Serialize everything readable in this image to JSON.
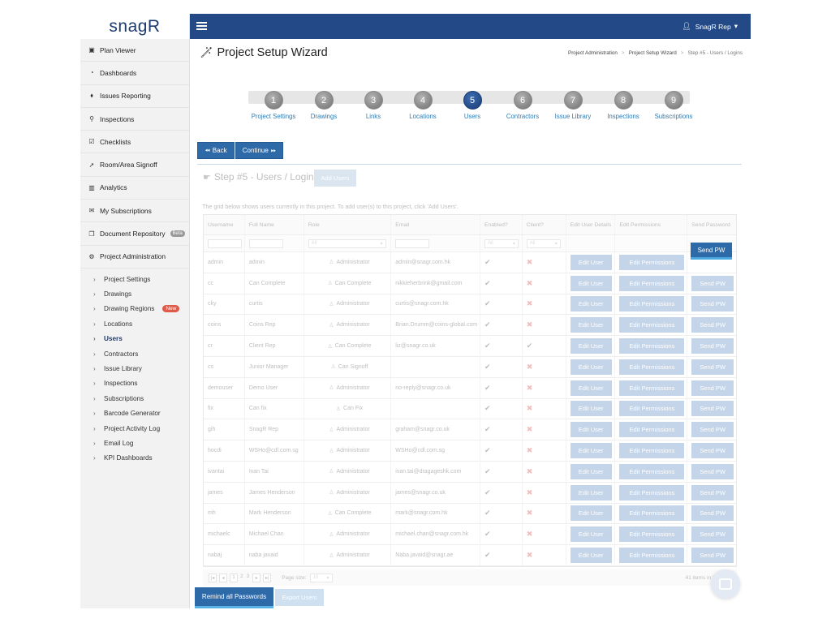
{
  "app": {
    "logo_text": "snagR"
  },
  "topbar": {
    "user_name": "SnagR Rep",
    "user_caret": "▾"
  },
  "sidebar": {
    "items": [
      {
        "label": "Plan Viewer",
        "icon": "image-icon",
        "glyph": "▣"
      },
      {
        "label": "Dashboards",
        "icon": "dashboard-icon",
        "glyph": "◔"
      },
      {
        "label": "Issues Reporting",
        "icon": "map-marker-icon",
        "glyph": "⬧"
      },
      {
        "label": "Inspections",
        "icon": "search-icon",
        "glyph": "⚲"
      },
      {
        "label": "Checklists",
        "icon": "checklist-icon",
        "glyph": "☑"
      },
      {
        "label": "Room/Area Signoff",
        "icon": "location-arrow-icon",
        "glyph": "➚"
      },
      {
        "label": "Analytics",
        "icon": "bar-chart-icon",
        "glyph": "▥"
      },
      {
        "label": "My Subscriptions",
        "icon": "envelope-icon",
        "glyph": "✉"
      },
      {
        "label": "Document Repository",
        "icon": "copy-icon",
        "glyph": "❐",
        "badge": "Beta"
      },
      {
        "label": "Project Administration",
        "icon": "cogs-icon",
        "glyph": "⚙"
      }
    ],
    "sub_items": [
      {
        "label": "Project Settings"
      },
      {
        "label": "Drawings"
      },
      {
        "label": "Drawing Regions",
        "badge": "New"
      },
      {
        "label": "Locations"
      },
      {
        "label": "Users"
      },
      {
        "label": "Contractors"
      },
      {
        "label": "Issue Library"
      },
      {
        "label": "Inspections"
      },
      {
        "label": "Subscriptions"
      },
      {
        "label": "Barcode Generator"
      },
      {
        "label": "Project Activity Log"
      },
      {
        "label": "Email Log"
      },
      {
        "label": "KPI Dashboards"
      }
    ]
  },
  "page": {
    "title": "Project Setup Wizard",
    "breadcrumb": [
      "Project Administration",
      "Project Setup Wizard",
      "Step #5 - Users / Logins"
    ]
  },
  "wizard": {
    "steps": [
      {
        "num": "1",
        "label": "Project Settings"
      },
      {
        "num": "2",
        "label": "Drawings"
      },
      {
        "num": "3",
        "label": "Links"
      },
      {
        "num": "4",
        "label": "Locations"
      },
      {
        "num": "5",
        "label": "Users"
      },
      {
        "num": "6",
        "label": "Contractors"
      },
      {
        "num": "7",
        "label": "Issue Library"
      },
      {
        "num": "8",
        "label": "Inspections"
      },
      {
        "num": "9",
        "label": "Subscriptions"
      }
    ],
    "active_step": 5,
    "back_label": "Back",
    "continue_label": "Continue"
  },
  "step": {
    "heading": "Step #5 - Users / Logins",
    "add_users_label": "Add Users",
    "description": "The grid below shows users currently in this project. To add user(s) to this project, click 'Add Users'."
  },
  "grid": {
    "columns": [
      "Username",
      "Full Name",
      "Role",
      "Email",
      "Enabled?",
      "Client?",
      "Edit User Details",
      "Edit Permissions",
      "Send Password"
    ],
    "filter_all": "All",
    "edit_user_label": "Edit User",
    "edit_permissions_label": "Edit Permissions",
    "send_pw_label": "Send PW",
    "rows": [
      {
        "username": "admin",
        "full_name": "admin",
        "role": "Administrator",
        "email": "admin@snagr.com.hk",
        "enabled": true,
        "client": false
      },
      {
        "username": "cc",
        "full_name": "Can Complete",
        "role": "Can Complete",
        "email": "nikkieherbrink@gmail.com",
        "enabled": true,
        "client": false
      },
      {
        "username": "cky",
        "full_name": "curtis",
        "role": "Administrator",
        "email": "curtis@snagr.com.hk",
        "enabled": true,
        "client": false
      },
      {
        "username": "coins",
        "full_name": "Coins Rep",
        "role": "Administrator",
        "email": "Brian.Drumm@coins-global.com",
        "enabled": true,
        "client": false
      },
      {
        "username": "cr",
        "full_name": "Client Rep",
        "role": "Can Complete",
        "email": "liz@snagr.co.uk",
        "enabled": true,
        "client": true
      },
      {
        "username": "cs",
        "full_name": "Junior Manager",
        "role": "Can Signoff",
        "email": "",
        "enabled": true,
        "client": false
      },
      {
        "username": "demouser",
        "full_name": "Demo User",
        "role": "Administrator",
        "email": "no-reply@snagr.co.uk",
        "enabled": true,
        "client": false
      },
      {
        "username": "fix",
        "full_name": "Can fix",
        "role": "Can Fix",
        "email": "",
        "enabled": true,
        "client": false
      },
      {
        "username": "gih",
        "full_name": "SnagR Rep",
        "role": "Administrator",
        "email": "graham@snagr.co.uk",
        "enabled": true,
        "client": false
      },
      {
        "username": "hocdi",
        "full_name": "WSHo@cdl.com.sg",
        "role": "Administrator",
        "email": "WSHo@cdl.com.sg",
        "enabled": true,
        "client": false
      },
      {
        "username": "ivantai",
        "full_name": "Ivan Tai",
        "role": "Administrator",
        "email": "ivan.tai@dragageshk.com",
        "enabled": true,
        "client": false
      },
      {
        "username": "james",
        "full_name": "James Henderson",
        "role": "Administrator",
        "email": "james@snagr.co.uk",
        "enabled": true,
        "client": false
      },
      {
        "username": "mh",
        "full_name": "Mark Henderson",
        "role": "Can Complete",
        "email": "mark@snagr.com.hk",
        "enabled": true,
        "client": false
      },
      {
        "username": "michaelc",
        "full_name": "Michael Chan",
        "role": "Administrator",
        "email": "michael.chan@snagr.com.hk",
        "enabled": true,
        "client": false
      },
      {
        "username": "nabaj",
        "full_name": "naba javaid",
        "role": "Administrator",
        "email": "Naba.javaid@snagr.ae",
        "enabled": true,
        "client": false
      }
    ],
    "pager": {
      "pages": [
        "1",
        "2",
        "3"
      ],
      "page_size_label": "Page size:",
      "page_size": "15",
      "info": "41 items in 3 pages"
    }
  },
  "bottom": {
    "remind_label": "Remind all Passwords",
    "export_label": "Export Users"
  }
}
